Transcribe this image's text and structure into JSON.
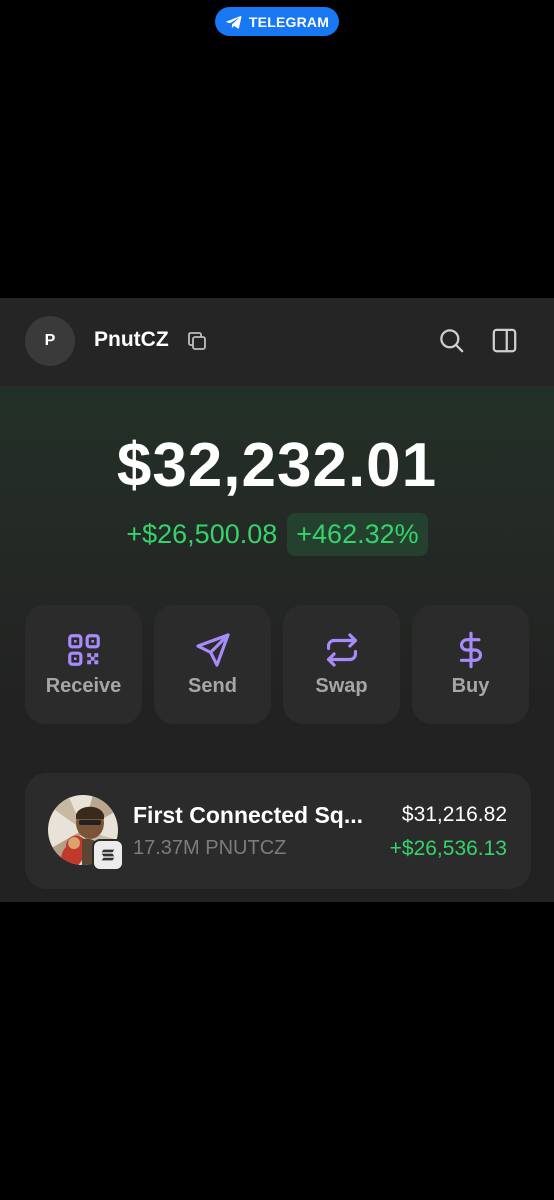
{
  "telegram": {
    "label": "TELEGRAM",
    "color": "#1877f2"
  },
  "header": {
    "avatar_letter": "P",
    "account_name": "PnutCZ",
    "icons": [
      "copy-icon",
      "search-icon",
      "side-panel-icon"
    ]
  },
  "balance": {
    "total": "$32,232.01",
    "change_amount": "+$26,500.08",
    "change_percent": "+462.32%",
    "positive_color": "#34d46b"
  },
  "actions": [
    {
      "label": "Receive",
      "icon": "qr-code-icon"
    },
    {
      "label": "Send",
      "icon": "send-icon"
    },
    {
      "label": "Swap",
      "icon": "swap-icon"
    },
    {
      "label": "Buy",
      "icon": "dollar-icon"
    }
  ],
  "accent_color": "#a78bfa",
  "tokens": [
    {
      "name": "First Connected Sq...",
      "amount": "17.37M PNUTCZ",
      "value": "$31,216.82",
      "change": "+$26,536.13",
      "chain_icon": "solana-icon"
    }
  ]
}
